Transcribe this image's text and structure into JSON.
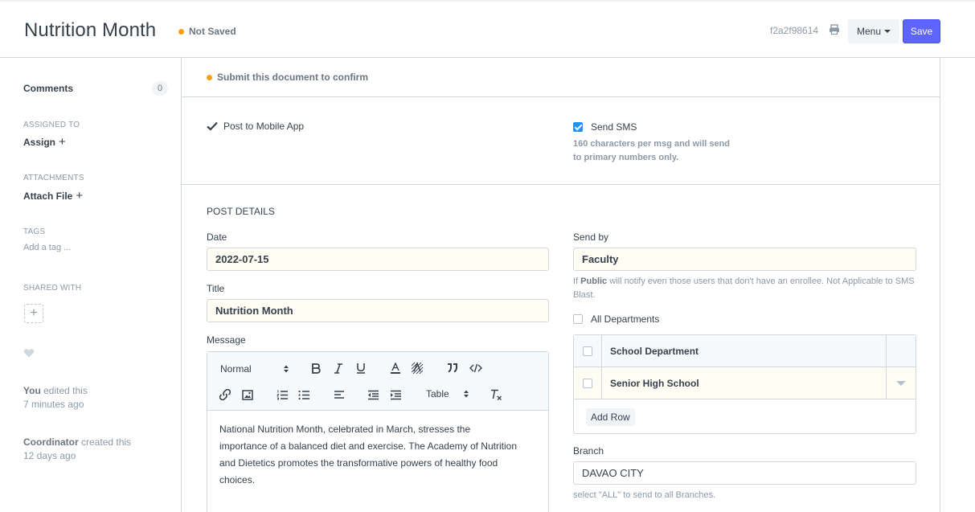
{
  "header": {
    "title": "Nutrition Month",
    "status": "Not Saved",
    "doc_id": "f2a2f98614",
    "menu_label": "Menu",
    "save_label": "Save"
  },
  "sidebar": {
    "comments_label": "Comments",
    "comments_count": "0",
    "assigned_to_label": "ASSIGNED TO",
    "assign_label": "Assign",
    "attachments_label": "ATTACHMENTS",
    "attach_label": "Attach File",
    "tags_label": "TAGS",
    "add_tag_label": "Add a tag ...",
    "shared_with_label": "SHARED WITH",
    "activity": [
      {
        "user": "You",
        "action": "edited this",
        "time": "7 minutes ago"
      },
      {
        "user": "Coordinator",
        "action": "created this",
        "time": "12 days ago"
      }
    ]
  },
  "main": {
    "confirm_text": "Submit this document to confirm",
    "post_to_mobile_label": "Post to Mobile App",
    "send_sms_label": "Send SMS",
    "send_sms_help": "160 characters per msg and will send to primary numbers only.",
    "section_title": "POST DETAILS",
    "date_label": "Date",
    "date_value": "2022-07-15",
    "title_label": "Title",
    "title_value": "Nutrition Month",
    "message_label": "Message",
    "editor": {
      "format_select": "Normal",
      "table_select": "Table"
    },
    "message_body": "National Nutrition Month, celebrated in March, stresses the importance of a balanced diet and exercise. The Academy of Nutrition and Dietetics promotes the transformative powers of healthy food choices.",
    "send_by_label": "Send by",
    "send_by_value": "Faculty",
    "send_by_help_prefix": "If ",
    "send_by_help_bold": "Public",
    "send_by_help_suffix": " will notify even those users that don't have an enrollee. Not Applicable to SMS Blast.",
    "all_departments_label": "All Departments",
    "dept_table": {
      "header": "School Department",
      "rows": [
        "Senior High School"
      ],
      "add_row_label": "Add Row"
    },
    "branch_label": "Branch",
    "branch_value": "DAVAO CITY",
    "branch_help": "select \"ALL\" to send to all Branches."
  },
  "colors": {
    "primary": "#5e64ff",
    "indicator_orange": "#ffa00a",
    "checkbox_blue": "#2490ef",
    "text": "#36414c",
    "muted": "#8d99a6"
  }
}
